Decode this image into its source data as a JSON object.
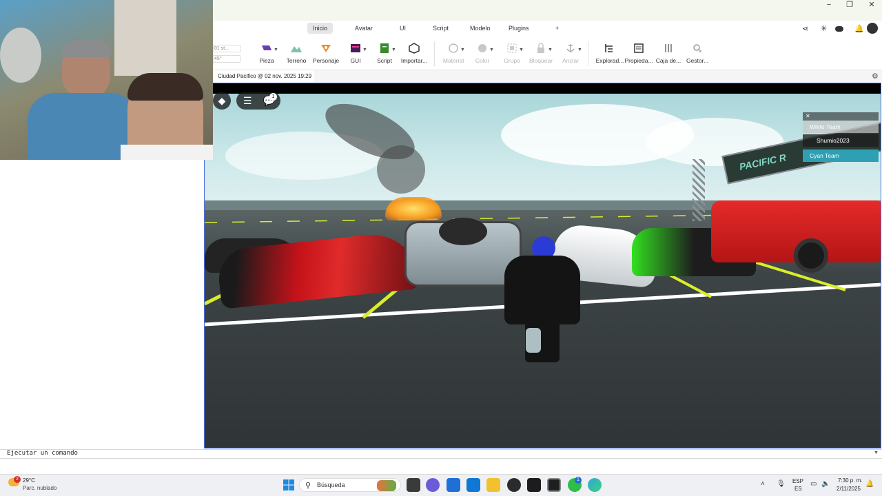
{
  "window": {
    "minimize": "−",
    "maximize": "❐",
    "close": "✕"
  },
  "ribbon_tabs": [
    "Inicio",
    "Avatar",
    "UI",
    "Script",
    "Modelo",
    "Plugins"
  ],
  "ribbon_add": "+",
  "toolbar": {
    "move_value": "01 st...",
    "rotate_value": "45°",
    "tools": [
      {
        "label": "Pieza"
      },
      {
        "label": "Terreno"
      },
      {
        "label": "Personaje"
      },
      {
        "label": "GUI"
      },
      {
        "label": "Script"
      },
      {
        "label": "Importar..."
      },
      {
        "label": "Material"
      },
      {
        "label": "Color"
      },
      {
        "label": "Grupo"
      },
      {
        "label": "Bloquear"
      },
      {
        "label": "Anclar"
      },
      {
        "label": "Explorad..."
      },
      {
        "label": "Propieda..."
      },
      {
        "label": "Caja de..."
      },
      {
        "label": "Gestor..."
      }
    ]
  },
  "doc_tab": {
    "title": "Ciudad Pacifico @ 02 nov. 2025 19:29",
    "close": "✕"
  },
  "viewport": {
    "chat_badge": "1",
    "player_list": {
      "close": "✕",
      "teams": [
        "White Team",
        "Shumio2023",
        "Cyan Team"
      ]
    },
    "banner_text": "PACIFIC R"
  },
  "command_bar": {
    "placeholder": "Ejecutar un comando"
  },
  "taskbar": {
    "weather_temp": "29°C",
    "weather_desc": "Parc. nublado",
    "weather_badge": "2",
    "search_label": "Búsqueda",
    "lang_top": "ESP",
    "lang_bottom": "ES",
    "time": "7:30 p. m.",
    "date": "2/11/2025",
    "whatsapp_badge": "1"
  },
  "colors": {
    "accent": "#4d6de0",
    "team_cyan": "#2f9fb4",
    "white_team": "#bdbdbd"
  }
}
